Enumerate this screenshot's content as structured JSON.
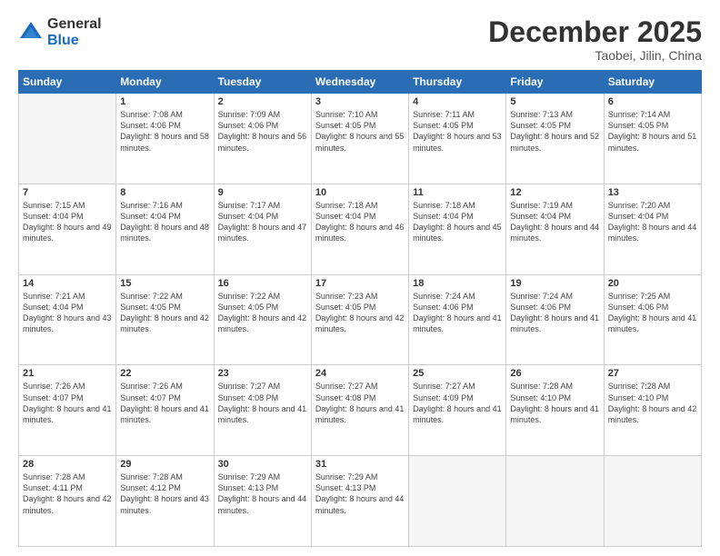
{
  "header": {
    "logo_general": "General",
    "logo_blue": "Blue",
    "month_title": "December 2025",
    "location": "Taobei, Jilin, China"
  },
  "days_of_week": [
    "Sunday",
    "Monday",
    "Tuesday",
    "Wednesday",
    "Thursday",
    "Friday",
    "Saturday"
  ],
  "weeks": [
    [
      {
        "day": "",
        "empty": true
      },
      {
        "day": "1",
        "sunrise": "7:08 AM",
        "sunset": "4:06 PM",
        "daylight": "8 hours and 58 minutes."
      },
      {
        "day": "2",
        "sunrise": "7:09 AM",
        "sunset": "4:06 PM",
        "daylight": "8 hours and 56 minutes."
      },
      {
        "day": "3",
        "sunrise": "7:10 AM",
        "sunset": "4:05 PM",
        "daylight": "8 hours and 55 minutes."
      },
      {
        "day": "4",
        "sunrise": "7:11 AM",
        "sunset": "4:05 PM",
        "daylight": "8 hours and 53 minutes."
      },
      {
        "day": "5",
        "sunrise": "7:13 AM",
        "sunset": "4:05 PM",
        "daylight": "8 hours and 52 minutes."
      },
      {
        "day": "6",
        "sunrise": "7:14 AM",
        "sunset": "4:05 PM",
        "daylight": "8 hours and 51 minutes."
      }
    ],
    [
      {
        "day": "7",
        "sunrise": "7:15 AM",
        "sunset": "4:04 PM",
        "daylight": "8 hours and 49 minutes."
      },
      {
        "day": "8",
        "sunrise": "7:16 AM",
        "sunset": "4:04 PM",
        "daylight": "8 hours and 48 minutes."
      },
      {
        "day": "9",
        "sunrise": "7:17 AM",
        "sunset": "4:04 PM",
        "daylight": "8 hours and 47 minutes."
      },
      {
        "day": "10",
        "sunrise": "7:18 AM",
        "sunset": "4:04 PM",
        "daylight": "8 hours and 46 minutes."
      },
      {
        "day": "11",
        "sunrise": "7:18 AM",
        "sunset": "4:04 PM",
        "daylight": "8 hours and 45 minutes."
      },
      {
        "day": "12",
        "sunrise": "7:19 AM",
        "sunset": "4:04 PM",
        "daylight": "8 hours and 44 minutes."
      },
      {
        "day": "13",
        "sunrise": "7:20 AM",
        "sunset": "4:04 PM",
        "daylight": "8 hours and 44 minutes."
      }
    ],
    [
      {
        "day": "14",
        "sunrise": "7:21 AM",
        "sunset": "4:04 PM",
        "daylight": "8 hours and 43 minutes."
      },
      {
        "day": "15",
        "sunrise": "7:22 AM",
        "sunset": "4:05 PM",
        "daylight": "8 hours and 42 minutes."
      },
      {
        "day": "16",
        "sunrise": "7:22 AM",
        "sunset": "4:05 PM",
        "daylight": "8 hours and 42 minutes."
      },
      {
        "day": "17",
        "sunrise": "7:23 AM",
        "sunset": "4:05 PM",
        "daylight": "8 hours and 42 minutes."
      },
      {
        "day": "18",
        "sunrise": "7:24 AM",
        "sunset": "4:06 PM",
        "daylight": "8 hours and 41 minutes."
      },
      {
        "day": "19",
        "sunrise": "7:24 AM",
        "sunset": "4:06 PM",
        "daylight": "8 hours and 41 minutes."
      },
      {
        "day": "20",
        "sunrise": "7:25 AM",
        "sunset": "4:06 PM",
        "daylight": "8 hours and 41 minutes."
      }
    ],
    [
      {
        "day": "21",
        "sunrise": "7:26 AM",
        "sunset": "4:07 PM",
        "daylight": "8 hours and 41 minutes."
      },
      {
        "day": "22",
        "sunrise": "7:26 AM",
        "sunset": "4:07 PM",
        "daylight": "8 hours and 41 minutes."
      },
      {
        "day": "23",
        "sunrise": "7:27 AM",
        "sunset": "4:08 PM",
        "daylight": "8 hours and 41 minutes."
      },
      {
        "day": "24",
        "sunrise": "7:27 AM",
        "sunset": "4:08 PM",
        "daylight": "8 hours and 41 minutes."
      },
      {
        "day": "25",
        "sunrise": "7:27 AM",
        "sunset": "4:09 PM",
        "daylight": "8 hours and 41 minutes."
      },
      {
        "day": "26",
        "sunrise": "7:28 AM",
        "sunset": "4:10 PM",
        "daylight": "8 hours and 41 minutes."
      },
      {
        "day": "27",
        "sunrise": "7:28 AM",
        "sunset": "4:10 PM",
        "daylight": "8 hours and 42 minutes."
      }
    ],
    [
      {
        "day": "28",
        "sunrise": "7:28 AM",
        "sunset": "4:11 PM",
        "daylight": "8 hours and 42 minutes."
      },
      {
        "day": "29",
        "sunrise": "7:28 AM",
        "sunset": "4:12 PM",
        "daylight": "8 hours and 43 minutes."
      },
      {
        "day": "30",
        "sunrise": "7:29 AM",
        "sunset": "4:13 PM",
        "daylight": "8 hours and 44 minutes."
      },
      {
        "day": "31",
        "sunrise": "7:29 AM",
        "sunset": "4:13 PM",
        "daylight": "8 hours and 44 minutes."
      },
      {
        "day": "",
        "empty": true
      },
      {
        "day": "",
        "empty": true
      },
      {
        "day": "",
        "empty": true
      }
    ]
  ]
}
